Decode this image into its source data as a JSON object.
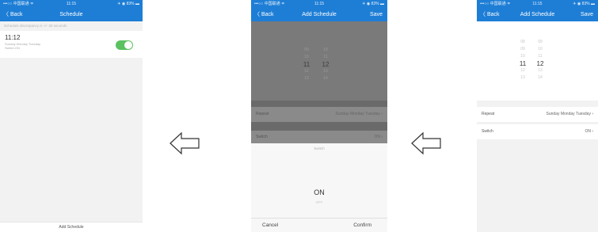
{
  "status": {
    "carrier": "•••○○ 中国联通 ≑",
    "time": "11:15",
    "battery": "✈ ◉ 83% ▬"
  },
  "panel1": {
    "back": "〈 Back",
    "title": "Schedule",
    "hint": "Schedule discrepancy is +/- 30 seconds",
    "item": {
      "time": "11:12",
      "days": "Sunday Monday Tuesday",
      "switch": "Switch:ON",
      "enabled": true
    },
    "add": "Add Schedule"
  },
  "panel2": {
    "back": "〈 Back",
    "title": "Add Schedule",
    "save": "Save",
    "hours": [
      "09",
      "10",
      "11",
      "12",
      "13"
    ],
    "minutes": [
      "10",
      "11",
      "12",
      "13",
      "14"
    ],
    "repeat_label": "Repeat",
    "repeat_value": "Sunday Monday Tuesday ›",
    "switch_label": "Switch",
    "switch_value": "ON ›",
    "sheet_title": "Switch",
    "sheet_on": "ON",
    "sheet_off": "OFF",
    "cancel": "Cancel",
    "confirm": "Confirm"
  },
  "panel3": {
    "back": "〈 Back",
    "title": "Add Schedule",
    "save": "Save",
    "hours": [
      "08",
      "09",
      "10",
      "11",
      "12",
      "13"
    ],
    "minutes": [
      "09",
      "10",
      "11",
      "12",
      "13",
      "14"
    ],
    "repeat_label": "Repeat",
    "repeat_value": "Sunday Monday Tuesday ›",
    "switch_label": "Switch",
    "switch_value": "ON ›"
  }
}
